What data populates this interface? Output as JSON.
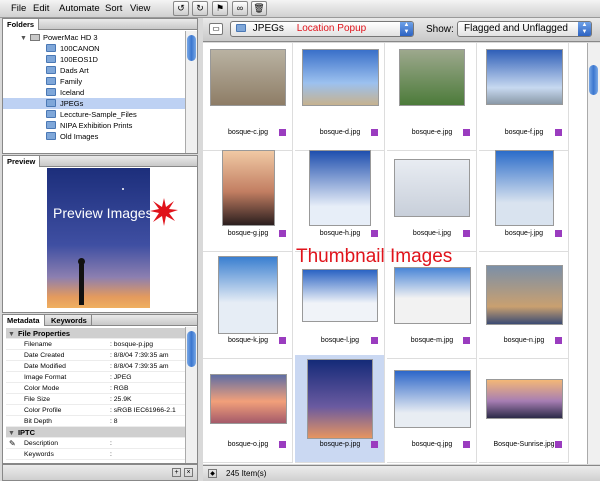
{
  "menu": [
    "File",
    "Edit",
    "Automate",
    "Sort",
    "View"
  ],
  "toolbar_icons": [
    "rotate-left-icon",
    "rotate-right-icon",
    "flag-icon",
    "binoculars-icon",
    "trash-icon"
  ],
  "folders": {
    "tab": "Folders",
    "items": [
      {
        "label": "PowerMac HD 3",
        "icon": "disk-icon",
        "indent": 0,
        "expanded": true
      },
      {
        "label": "100CANON",
        "icon": "folder-icon",
        "indent": 1
      },
      {
        "label": "100EOS1D",
        "icon": "folder-icon",
        "indent": 1
      },
      {
        "label": "Dads Art",
        "icon": "folder-icon",
        "indent": 1
      },
      {
        "label": "Family",
        "icon": "folder-icon",
        "indent": 1
      },
      {
        "label": "Iceland",
        "icon": "folder-icon",
        "indent": 1
      },
      {
        "label": "JPEGs",
        "icon": "folder-icon",
        "indent": 1,
        "selected": true
      },
      {
        "label": "Leccture-Sample_Files",
        "icon": "folder-icon",
        "indent": 1
      },
      {
        "label": "NIPA Exhibition Prints",
        "icon": "folder-icon",
        "indent": 1
      },
      {
        "label": "Old Images",
        "icon": "folder-icon",
        "indent": 1
      }
    ]
  },
  "preview": {
    "tab": "Preview",
    "annotation": "Preview Images"
  },
  "metadata": {
    "tabs": [
      "Metadata",
      "Keywords"
    ],
    "sections": [
      {
        "title": "File Properties",
        "rows": [
          {
            "label": "Filename",
            "value": ": bosque-p.jpg"
          },
          {
            "label": "Date Created",
            "value": ": 8/8/04 7:39:35 am"
          },
          {
            "label": "Date Modified",
            "value": ": 8/8/04 7:39:35 am"
          },
          {
            "label": "Image Format",
            "value": ": JPEG"
          },
          {
            "label": "Color Mode",
            "value": ": RGB"
          },
          {
            "label": "File Size",
            "value": ": 25.9K"
          },
          {
            "label": "Color Profile",
            "value": ": sRGB IEC61966-2.1"
          },
          {
            "label": "Bit Depth",
            "value": ": 8"
          }
        ]
      },
      {
        "title": "IPTC",
        "rows": [
          {
            "label": "Description",
            "value": ":"
          },
          {
            "label": "Keywords",
            "value": ":"
          }
        ]
      }
    ]
  },
  "topbar": {
    "location_value": "JPEGs",
    "location_annotation": "Location Popup",
    "show_label": "Show:",
    "show_value": "Flagged and Unflagged"
  },
  "grid_annotation": "Thumbnail Images",
  "thumbnails": [
    {
      "caption": "bosque-c.jpg"
    },
    {
      "caption": "bosque-d.jpg"
    },
    {
      "caption": "bosque-e.jpg"
    },
    {
      "caption": "bosque-f.jpg"
    },
    {
      "caption": "bosque-g.jpg"
    },
    {
      "caption": "bosque-h.jpg"
    },
    {
      "caption": "bosque-i.jpg"
    },
    {
      "caption": "bosque-j.jpg"
    },
    {
      "caption": "bosque-k.jpg"
    },
    {
      "caption": "bosque-l.jpg"
    },
    {
      "caption": "bosque-m.jpg"
    },
    {
      "caption": "bosque-n.jpg"
    },
    {
      "caption": "bosque-o.jpg"
    },
    {
      "caption": "bosque-p.jpg",
      "selected": true
    },
    {
      "caption": "bosque-q.jpg"
    },
    {
      "caption": "Bosque-Sunrise.jpg"
    }
  ],
  "status": {
    "count": "245 Item(s)"
  },
  "colors": {
    "accent": "#3b76cf",
    "annotation": "#e0131b",
    "flag": "#9a3cbf",
    "selection": "#cad8f2"
  }
}
